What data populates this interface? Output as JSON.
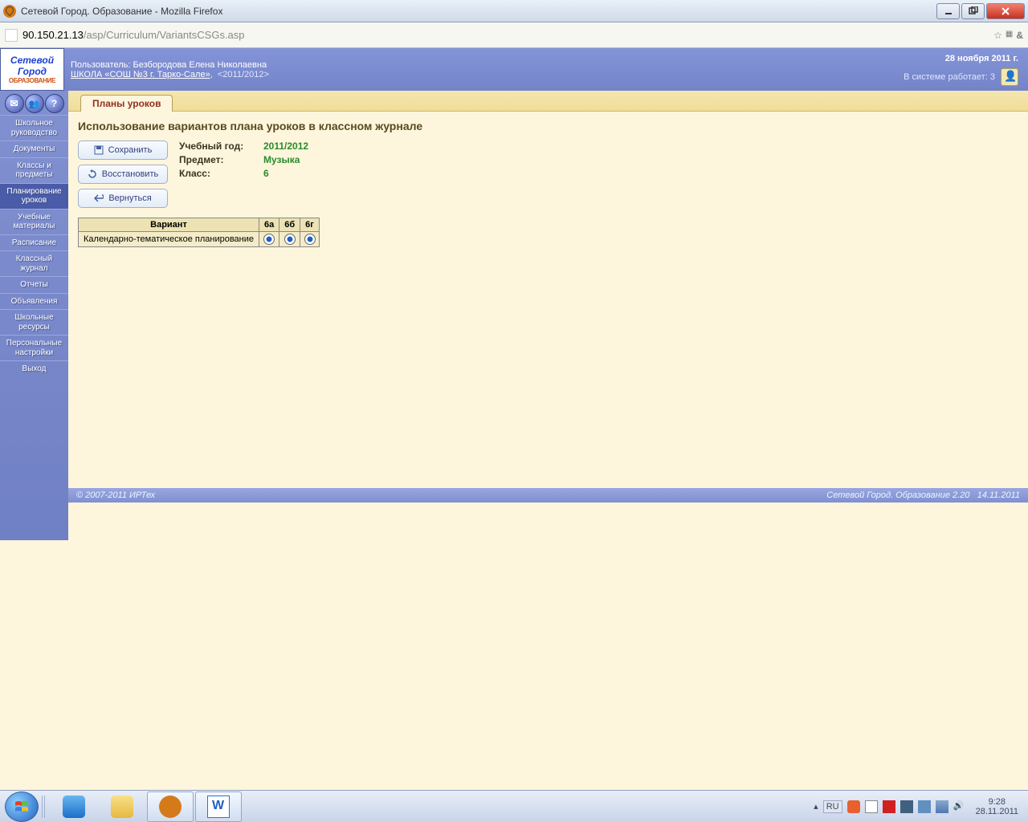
{
  "window": {
    "title": "Сетевой Город. Образование - Mozilla Firefox"
  },
  "url": {
    "host": "90.150.21.13",
    "path": "/asp/Curriculum/VariantsCSGs.asp"
  },
  "header": {
    "user_label": "Пользователь: ",
    "user_name": "Безбородова Елена Николаевна",
    "school_link": "ШКОЛА «СОШ №3 г. Тарко-Сале»",
    "year_tag": "<2011/2012>",
    "date": "28 ноября 2011 г.",
    "online_label": "В системе работает: ",
    "online_count": "3"
  },
  "logo": {
    "line1": "Сетевой",
    "line2": "Город",
    "line3": "ОБРАЗОВАНИЕ"
  },
  "tab": {
    "label": "Планы уроков"
  },
  "sidebar": {
    "items": [
      "Школьное руководство",
      "Документы",
      "Классы и предметы",
      "Планирование уроков",
      "Учебные материалы",
      "Расписание",
      "Классный журнал",
      "Отчеты",
      "Объявления",
      "Школьные ресурсы",
      "Персональные настройки",
      "Выход"
    ],
    "active_index": 3
  },
  "page": {
    "title": "Использование вариантов плана уроков в классном журнале",
    "buttons": {
      "save": "Сохранить",
      "restore": "Восстановить",
      "back": "Вернуться"
    },
    "info": {
      "year_label": "Учебный год:",
      "year_value": "2011/2012",
      "subject_label": "Предмет:",
      "subject_value": "Музыка",
      "class_label": "Класс:",
      "class_value": "6"
    },
    "table": {
      "variant_header": "Вариант",
      "columns": [
        "6а",
        "6б",
        "6г"
      ],
      "row_label": "Календарно-тематическое планирование"
    }
  },
  "footer": {
    "copyright": "© 2007-2011 ИРТех",
    "product": "Сетевой Город. Образование 2.20",
    "date": "14.11.2011"
  },
  "taskbar": {
    "lang": "RU",
    "time": "9:28",
    "date": "28.11.2011"
  }
}
